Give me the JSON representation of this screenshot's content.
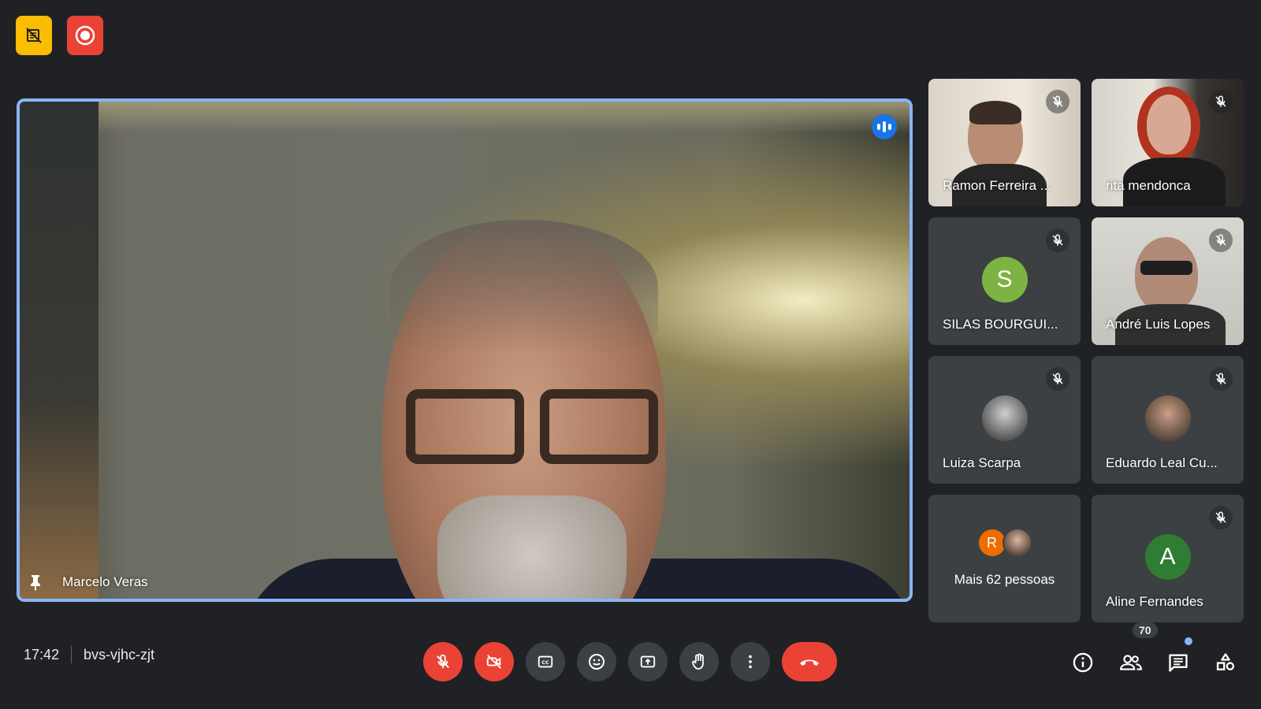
{
  "meeting": {
    "time": "17:42",
    "code": "bvs-vjhc-zjt"
  },
  "main_speaker": {
    "name": "Marcelo Veras",
    "pinned": true,
    "speaking": true
  },
  "tiles": [
    {
      "name": "Ramon Ferreira ...",
      "muted": true,
      "type": "video"
    },
    {
      "name": "rita mendonca",
      "muted": true,
      "type": "video"
    },
    {
      "name": "SILAS BOURGUI...",
      "muted": true,
      "type": "avatar",
      "initial": "S",
      "color": "#7cb342"
    },
    {
      "name": "André Luis Lopes",
      "muted": true,
      "type": "video"
    },
    {
      "name": "Luiza Scarpa",
      "muted": true,
      "type": "photo-avatar"
    },
    {
      "name": "Eduardo Leal Cu...",
      "muted": true,
      "type": "photo-avatar"
    },
    {
      "name": "Mais 62 pessoas",
      "type": "more",
      "avatar_initial": "R",
      "avatar_color": "#ef6c00"
    },
    {
      "name": "Aline Fernandes",
      "muted": true,
      "type": "avatar",
      "initial": "A",
      "color": "#2e7d32"
    }
  ],
  "people_count": "70",
  "colors": {
    "background": "#202124",
    "tile": "#3c4043",
    "accent_blue": "#8ab4f8",
    "danger_red": "#ea4335",
    "warning_yellow": "#fbbc04"
  },
  "controls": [
    {
      "id": "mic",
      "icon": "mic-off-icon",
      "state": "off"
    },
    {
      "id": "camera",
      "icon": "videocam-off-icon",
      "state": "off"
    },
    {
      "id": "captions",
      "icon": "closed-caption-icon"
    },
    {
      "id": "reactions",
      "icon": "emoji-icon"
    },
    {
      "id": "present",
      "icon": "present-screen-icon"
    },
    {
      "id": "raise-hand",
      "icon": "hand-icon"
    },
    {
      "id": "more",
      "icon": "more-vert-icon"
    },
    {
      "id": "leave",
      "icon": "call-end-icon"
    }
  ],
  "right_controls": [
    {
      "id": "info",
      "icon": "info-icon"
    },
    {
      "id": "people",
      "icon": "people-icon"
    },
    {
      "id": "chat",
      "icon": "chat-icon"
    },
    {
      "id": "activities",
      "icon": "activities-icon"
    }
  ]
}
